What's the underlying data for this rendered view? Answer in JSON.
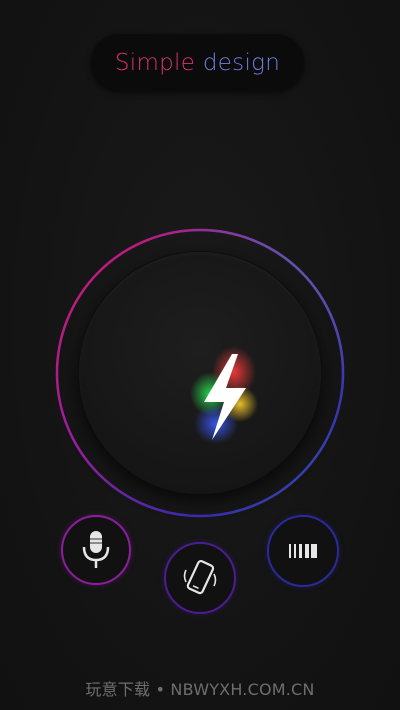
{
  "header": {
    "title_part1": "Simple",
    "title_part2": "design",
    "title_colors": [
      "#d6336c",
      "#6f7fe0"
    ]
  },
  "main": {
    "center_button_icon": "lightning-bolt-icon",
    "ring_gradient": [
      "#d01a6a",
      "#8a1fa0",
      "#3b2bb0",
      "#2aa0b0"
    ]
  },
  "controls": [
    {
      "id": "mic",
      "icon": "microphone-icon",
      "color": "#8a1f9b"
    },
    {
      "id": "shake",
      "icon": "phone-shake-icon",
      "color": "#4a1d90"
    },
    {
      "id": "barcode",
      "icon": "strobe-bars-icon",
      "color": "#2a2a9a"
    }
  ],
  "footer": {
    "watermark": "玩意下载 • NBWYXH.COM.CN"
  }
}
